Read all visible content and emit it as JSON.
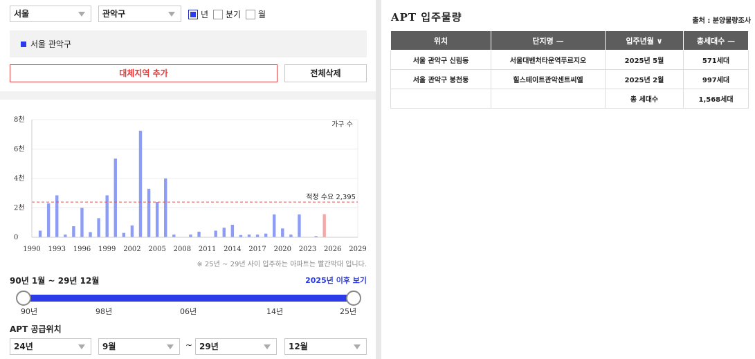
{
  "filters": {
    "city": "서울",
    "district": "관악구",
    "period_options": [
      {
        "label": "년",
        "checked": true
      },
      {
        "label": "분기",
        "checked": false
      },
      {
        "label": "월",
        "checked": false
      }
    ]
  },
  "region": {
    "selected_label": "서울 관악구",
    "color": "#2b3be8"
  },
  "buttons": {
    "add_alt_region": "대체지역 추가",
    "delete_all": "전체삭제"
  },
  "chart_data": {
    "type": "bar",
    "legend": "가구 수",
    "ylabel": "",
    "xlabel": "",
    "ylim": [
      0,
      8000
    ],
    "yticks": [
      {
        "value": 0,
        "label": "0"
      },
      {
        "value": 2000,
        "label": "2천"
      },
      {
        "value": 4000,
        "label": "4천"
      },
      {
        "value": 6000,
        "label": "6천"
      },
      {
        "value": 8000,
        "label": "8천"
      }
    ],
    "xlim": [
      1990,
      2029
    ],
    "xticks": [
      1990,
      1993,
      1996,
      1999,
      2002,
      2005,
      2008,
      2011,
      2014,
      2017,
      2020,
      2023,
      2026,
      2029
    ],
    "series": [
      {
        "name": "서울 관악구",
        "color": "#8d9cf5",
        "points": [
          {
            "year": 1991,
            "value": 450
          },
          {
            "year": 1992,
            "value": 2300
          },
          {
            "year": 1993,
            "value": 2850
          },
          {
            "year": 1994,
            "value": 180
          },
          {
            "year": 1995,
            "value": 750
          },
          {
            "year": 1996,
            "value": 2000
          },
          {
            "year": 1997,
            "value": 350
          },
          {
            "year": 1998,
            "value": 1300
          },
          {
            "year": 1999,
            "value": 2850
          },
          {
            "year": 2000,
            "value": 5350
          },
          {
            "year": 2001,
            "value": 300
          },
          {
            "year": 2002,
            "value": 800
          },
          {
            "year": 2003,
            "value": 7250
          },
          {
            "year": 2004,
            "value": 3300
          },
          {
            "year": 2005,
            "value": 2400
          },
          {
            "year": 2006,
            "value": 4000
          },
          {
            "year": 2007,
            "value": 180
          },
          {
            "year": 2009,
            "value": 180
          },
          {
            "year": 2010,
            "value": 380
          },
          {
            "year": 2012,
            "value": 450
          },
          {
            "year": 2013,
            "value": 650
          },
          {
            "year": 2014,
            "value": 850
          },
          {
            "year": 2015,
            "value": 150
          },
          {
            "year": 2016,
            "value": 180
          },
          {
            "year": 2017,
            "value": 180
          },
          {
            "year": 2018,
            "value": 250
          },
          {
            "year": 2019,
            "value": 1550
          },
          {
            "year": 2020,
            "value": 600
          },
          {
            "year": 2021,
            "value": 180
          },
          {
            "year": 2022,
            "value": 1550
          },
          {
            "year": 2024,
            "value": 80
          }
        ]
      },
      {
        "name": "25년 ~ 29년",
        "color": "#f4a9a9",
        "points": [
          {
            "year": 2025,
            "value": 1568
          }
        ]
      }
    ],
    "reference_line": {
      "label": "적정 수요 2,395",
      "value": 2395,
      "color": "#e05050"
    },
    "grid": true
  },
  "chart_note": "※ 25년 ~ 29년 사이 입주하는 아파트는 빨간막대 입니다.",
  "range": {
    "label": "90년 1월 ~ 29년 12월",
    "link": "2025년 이후 보기",
    "start_fraction": 0,
    "end_fraction": 1,
    "ticks": [
      "90년",
      "98년",
      "06년",
      "14년",
      "25년"
    ]
  },
  "supply": {
    "title": "APT 공급위치",
    "from_year": "24년",
    "from_month": "9월",
    "separator": "~",
    "to_year": "29년",
    "to_month": "12월"
  },
  "apt": {
    "title": "APT 입주물량",
    "source": "출처 : 분양물량조사",
    "columns": [
      "위치",
      "단지명 —",
      "입주년월 ∨",
      "총세대수 —"
    ],
    "rows": [
      [
        "서울 관악구 신림동",
        "서울대벤처타운역푸르지오",
        "2025년 5월",
        "571세대"
      ],
      [
        "서울 관악구 봉천동",
        "힐스테이트관악센트씨엘",
        "2025년 2월",
        "997세대"
      ],
      [
        "",
        "",
        "총 세대수",
        "1,568세대"
      ]
    ]
  }
}
